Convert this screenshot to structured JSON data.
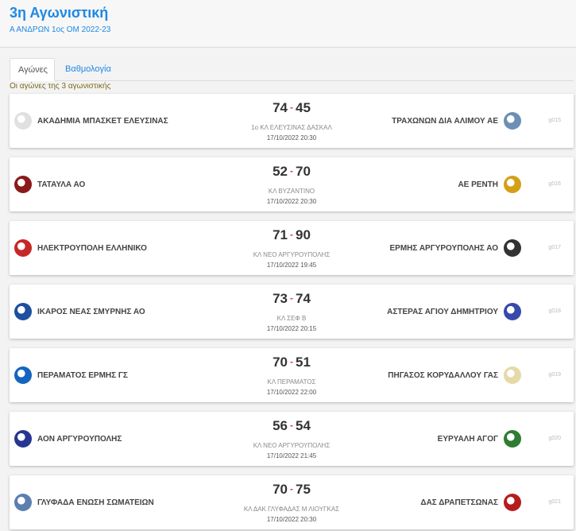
{
  "header": {
    "title": "3η Αγωνιστική",
    "subtitle": "Α ΑΝΔΡΩΝ 1ος ΟΜ 2022-23"
  },
  "tabs": [
    {
      "label": "Αγώνες",
      "active": true
    },
    {
      "label": "Βαθμολογία",
      "active": false
    }
  ],
  "section_note": "Οι αγώνες της 3 αγωνιστικής",
  "matches": [
    {
      "home": "ΑΚΑΔΗΜΙΑ ΜΠΑΣΚΕΤ ΕΛΕΥΣΙΝΑΣ",
      "home_color": "#e0e0e0",
      "away": "ΤΡΑΧΩΝΩΝ ΔΙΑ ΑΛΙΜΟΥ ΑΕ",
      "away_color": "#6d8fb5",
      "home_score": "74",
      "away_score": "45",
      "venue": "1ο ΚΛ ΕΛΕΥΣΙΝΑΣ ΔΑΣΚΑΛ",
      "datetime": "17/10/2022 20:30",
      "code": "g015"
    },
    {
      "home": "ΤΑΤΑΥΛΑ ΑΟ",
      "home_color": "#8b1a1a",
      "away": "ΑΕ ΡΕΝΤΗ",
      "away_color": "#d4a017",
      "home_score": "52",
      "away_score": "70",
      "venue": "ΚΛ ΒΥΖΑΝΤΙΝΟ",
      "datetime": "17/10/2022 20:30",
      "code": "g016"
    },
    {
      "home": "ΗΛΕΚΤΡΟΥΠΟΛΗ ΕΛΛΗΝΙΚΟ",
      "home_color": "#c62828",
      "away": "ΕΡΜΗΣ ΑΡΓΥΡΟΥΠΟΛΗΣ ΑΟ",
      "away_color": "#333333",
      "home_score": "71",
      "away_score": "90",
      "venue": "ΚΛ ΝΕΟ ΑΡΓΥΡΟΥΠΟΛΗΣ",
      "datetime": "17/10/2022 19:45",
      "code": "g017"
    },
    {
      "home": "ΙΚΑΡΟΣ ΝΕΑΣ ΣΜΥΡΝΗΣ ΑΟ",
      "home_color": "#1e4fa0",
      "away": "ΑΣΤΕΡΑΣ ΑΓΙΟΥ ΔΗΜΗΤΡΙΟΥ",
      "away_color": "#3949ab",
      "home_score": "73",
      "away_score": "74",
      "venue": "ΚΛ ΣΕΦ Β",
      "datetime": "17/10/2022 20:15",
      "code": "g018"
    },
    {
      "home": "ΠΕΡΑΜΑΤΟΣ ΕΡΜΗΣ ΓΣ",
      "home_color": "#1565c0",
      "away": "ΠΗΓΑΣΟΣ ΚΟΡΥΔΑΛΛΟΥ ΓΑΣ",
      "away_color": "#e6d9a8",
      "home_score": "70",
      "away_score": "51",
      "venue": "ΚΛ ΠΕΡΑΜΑΤΟΣ",
      "datetime": "17/10/2022 22:00",
      "code": "g019"
    },
    {
      "home": "ΑΟΝ ΑΡΓΥΡΟΥΠΟΛΗΣ",
      "home_color": "#283593",
      "away": "ΕΥΡΥΑΛΗ ΑΓΟΓ",
      "away_color": "#2e7d32",
      "home_score": "56",
      "away_score": "54",
      "venue": "ΚΛ ΝΕΟ ΑΡΓΥΡΟΥΠΟΛΗΣ",
      "datetime": "17/10/2022 21:45",
      "code": "g020"
    },
    {
      "home": "ΓΛΥΦΑΔΑ ΕΝΩΣΗ ΣΩΜΑΤΕΙΩΝ",
      "home_color": "#5c7fb0",
      "away": "ΔΑΣ ΔΡΑΠΕΤΣΩΝΑΣ",
      "away_color": "#b71c1c",
      "home_score": "70",
      "away_score": "75",
      "venue": "ΚΛ ΔΑΚ ΓΛΥΦΑΔΑΣ Μ ΛΙΟΥΓΚΑΣ",
      "datetime": "17/10/2022 20:30",
      "code": "g021"
    }
  ]
}
